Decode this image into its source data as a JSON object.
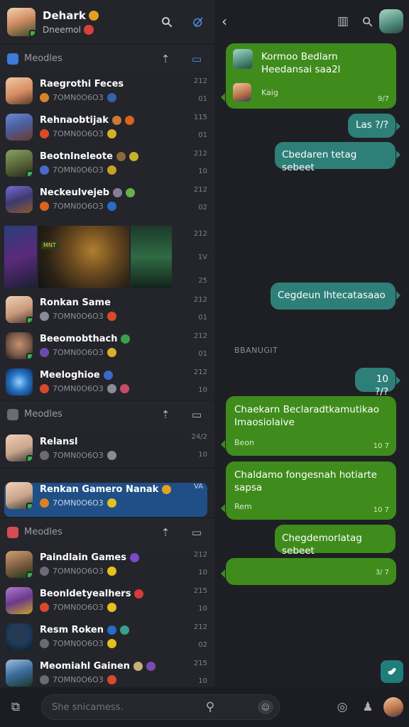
{
  "me": {
    "name": "Dehark",
    "status": "Dneemol"
  },
  "sections": [
    {
      "title": "Meodles",
      "accent": "#3d7bd8"
    },
    {
      "title": "Meodles",
      "accent": "#6a6b73"
    },
    {
      "title": "Meodles",
      "accent": "#d84a55"
    }
  ],
  "chats": [
    {
      "name": "Raegrothi Feces",
      "sub": "7OMN0O6O3",
      "time": "212",
      "num": "01",
      "color": "#d58d64"
    },
    {
      "name": "Rehnaobtijak",
      "sub": "7OMN0O6O3",
      "time": "115",
      "num": "01",
      "color": "#4a5fa0"
    },
    {
      "name": "Beotnlneleote",
      "sub": "7OMN0O6O3",
      "time": "212",
      "num": "10",
      "color": "#5a6a3a"
    },
    {
      "name": "Neckeulvejeb",
      "sub": "7OMN0O6O3",
      "time": "212",
      "num": "02",
      "color": "#3c3a70"
    },
    {
      "name": "",
      "sub": "",
      "time": "212",
      "num": "25",
      "color": "#3a3a3a"
    },
    {
      "name": "Ronkan Same",
      "sub": "7OMN0O6O3",
      "time": "212",
      "num": "01",
      "color": "#d7b59a"
    },
    {
      "name": "Beeomobthach",
      "sub": "7OMN0O6O3",
      "time": "212",
      "num": "01",
      "color": "#7a5a4a"
    },
    {
      "name": "Meeloghioe",
      "sub": "7OMN0O6O3",
      "time": "212",
      "num": "10",
      "color": "#2a78c8"
    },
    {
      "name": "Relansl",
      "sub": "7OMN0O6O3",
      "time": "24/2",
      "num": "10",
      "color": "#c9a58a"
    },
    {
      "name": "Renkan Gamero Nanak",
      "sub": "7OMN0O6O3",
      "time": "VA",
      "num": "",
      "color": "#c9a58a"
    },
    {
      "name": "Paindlain Games",
      "sub": "7OMN0O6O3",
      "time": "212",
      "num": "10",
      "color": "#7a5a40"
    },
    {
      "name": "Beonldetyealhers",
      "sub": "7OMN0O6O3",
      "time": "215",
      "num": "10",
      "color": "#6a3a8a"
    },
    {
      "name": "Resm Roken",
      "sub": "7OMN0O6O3",
      "time": "212",
      "num": "02",
      "color": "#1f3a5a"
    },
    {
      "name": "Meomiahl Gainen",
      "sub": "7OMN0O6O3",
      "time": "215",
      "num": "10",
      "color": "#3a6a9a"
    }
  ],
  "banner": {
    "tag": "MNT"
  },
  "messages": [
    {
      "text": "Kormoo Bedlarn Heedansai saa2l",
      "time": "9/7",
      "sub": "Kaig"
    },
    {
      "text": "Las ?/?"
    },
    {
      "text": "Cbedaren tetag sebeet"
    },
    {
      "text": "Cegdeun Ihtecatasaao"
    },
    {
      "text": "10 ?/?"
    },
    {
      "text": "Chaekarn Beclaradtkamutikao Imaosiolaive",
      "time": "10 7",
      "sub": "Beon"
    },
    {
      "text": "Chaldamo fongesnah hotiarte sapsa",
      "time": "10 7",
      "sub": "Rem"
    },
    {
      "text": "Chegdemorlatag sebeet"
    },
    {
      "text": "",
      "time": "3/ 7"
    }
  ],
  "date_separator": "BBANUGIT",
  "composer": {
    "placeholder": "She snicamess."
  },
  "colors": {
    "green_bubble": "#3f8c1c",
    "teal_bubble": "#2e7f78",
    "selected_row": "#1f4f86"
  }
}
